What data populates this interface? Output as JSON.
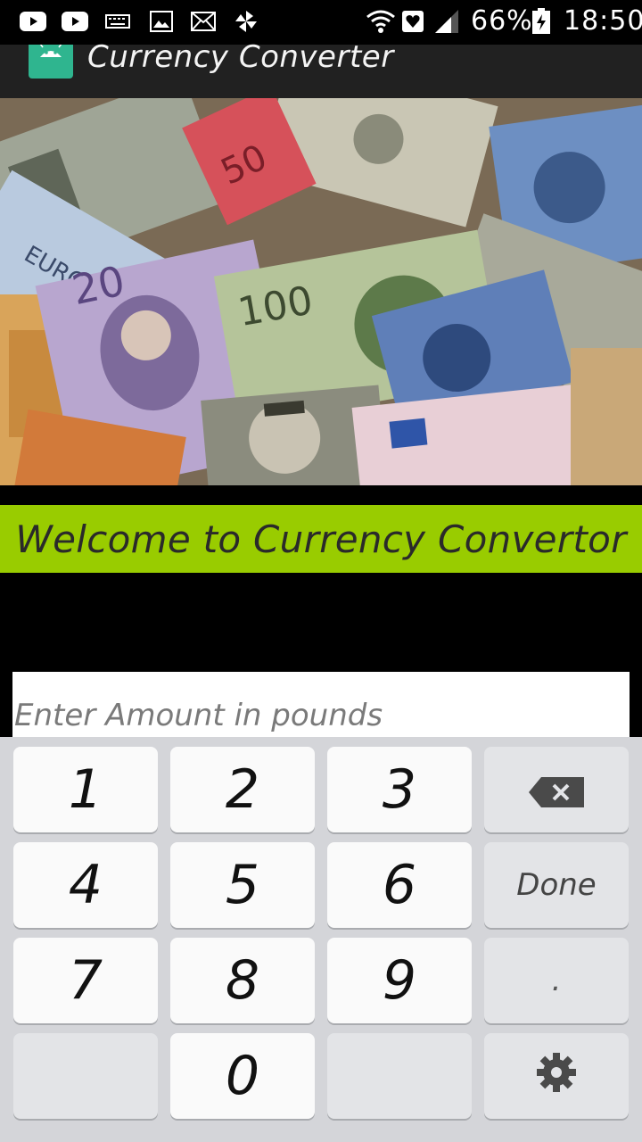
{
  "status_bar": {
    "battery": "66%",
    "time": "18:50",
    "icons": [
      "youtube-icon",
      "youtube-icon",
      "keyboard-icon",
      "image-icon",
      "mail-icon",
      "pinwheel-icon",
      "wifi-icon",
      "heart-icon",
      "signal-icon",
      "battery-icon"
    ]
  },
  "app_bar": {
    "title": "Currency Converter",
    "logo_icon": "android-icon"
  },
  "banner": {
    "description_icon": "currency-banknotes-image"
  },
  "welcome": {
    "text": "Welcome to Currency Convertor"
  },
  "amount_input": {
    "value": "",
    "placeholder": "Enter Amount in pounds"
  },
  "keyboard": {
    "keys": {
      "k1": "1",
      "k2": "2",
      "k3": "3",
      "k4": "4",
      "k5": "5",
      "k6": "6",
      "k7": "7",
      "k8": "8",
      "k9": "9",
      "k0": "0",
      "done": "Done",
      "dot": "."
    },
    "backspace_icon": "backspace-icon",
    "settings_icon": "gear-icon"
  },
  "colors": {
    "welcome_bg": "#99cc00",
    "app_bar_bg": "#212121",
    "keyboard_bg": "#d4d5d9"
  }
}
